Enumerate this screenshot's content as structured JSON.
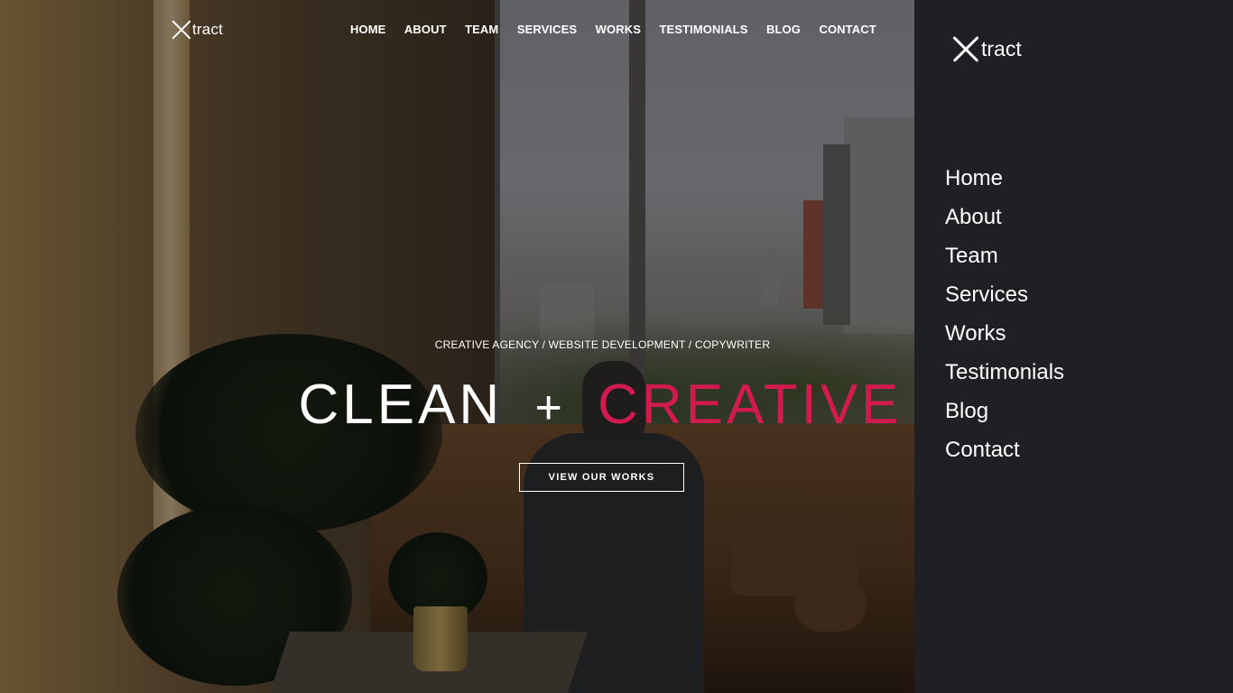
{
  "brand": {
    "name": "tract"
  },
  "topnav": {
    "items": [
      "HOME",
      "ABOUT",
      "TEAM",
      "SERVICES",
      "WORKS",
      "TESTIMONIALS",
      "BLOG",
      "CONTACT"
    ]
  },
  "hero": {
    "tagline": "CREATIVE AGENCY / WEBSITE DEVELOPMENT / COPYWRITER",
    "headline_part1": "CLEAN",
    "headline_plus": "+",
    "headline_part2": "CREATIVE",
    "cta_label": "VIEW OUR WORKS",
    "accent_color": "#d11a4d"
  },
  "side_menu": {
    "items": [
      "Home",
      "About",
      "Team",
      "Services",
      "Works",
      "Testimonials",
      "Blog",
      "Contact"
    ]
  },
  "colors": {
    "panel_bg": "#1e2023",
    "text": "#ffffff"
  }
}
